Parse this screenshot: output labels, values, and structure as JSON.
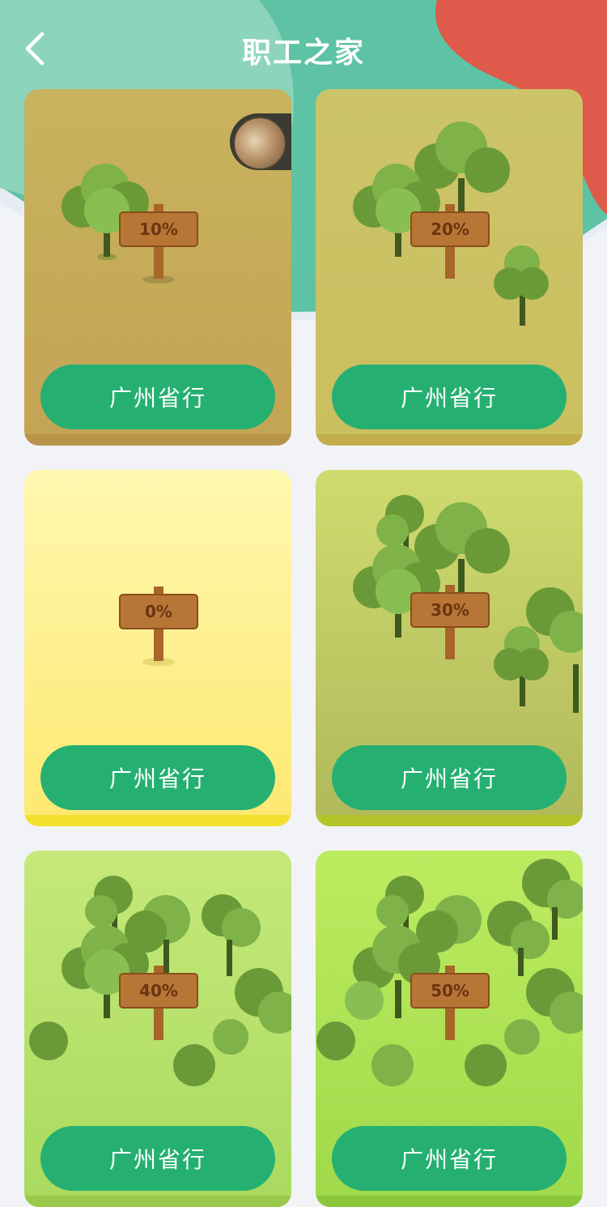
{
  "header": {
    "title": "职工之家",
    "back_icon": "chevron-left-icon"
  },
  "colors": {
    "hero_teal": "#5dc3a4",
    "hero_light_teal": "#8dd4bd",
    "hero_red": "#de5a4a",
    "button_green": "#25b072",
    "button_text": "#ffffff"
  },
  "cards": [
    {
      "percent": "10%",
      "button_label": "广州省行",
      "has_avatar": true,
      "bg_top": "#c8b35e",
      "bg_bottom": "#c3a455",
      "strip": "#b8934a"
    },
    {
      "percent": "20%",
      "button_label": "广州省行",
      "has_avatar": false,
      "bg_top": "#cdc46a",
      "bg_bottom": "#c9bf5e",
      "strip": "#c1ad4c"
    },
    {
      "percent": "0%",
      "button_label": "广州省行",
      "has_avatar": false,
      "bg_top": "#fff8b0",
      "bg_bottom": "#fde870",
      "strip": "#f3df2e"
    },
    {
      "percent": "30%",
      "button_label": "广州省行",
      "has_avatar": false,
      "bg_top": "#cfdb6e",
      "bg_bottom": "#b0b85a",
      "strip": "#b3c42a"
    },
    {
      "percent": "40%",
      "button_label": "广州省行",
      "has_avatar": false,
      "bg_top": "#c5e97a",
      "bg_bottom": "#a9da5e",
      "strip": "#9ac84a"
    },
    {
      "percent": "50%",
      "button_label": "广州省行",
      "has_avatar": false,
      "bg_top": "#bdeb60",
      "bg_bottom": "#9fd94a",
      "strip": "#8cc63a"
    }
  ]
}
